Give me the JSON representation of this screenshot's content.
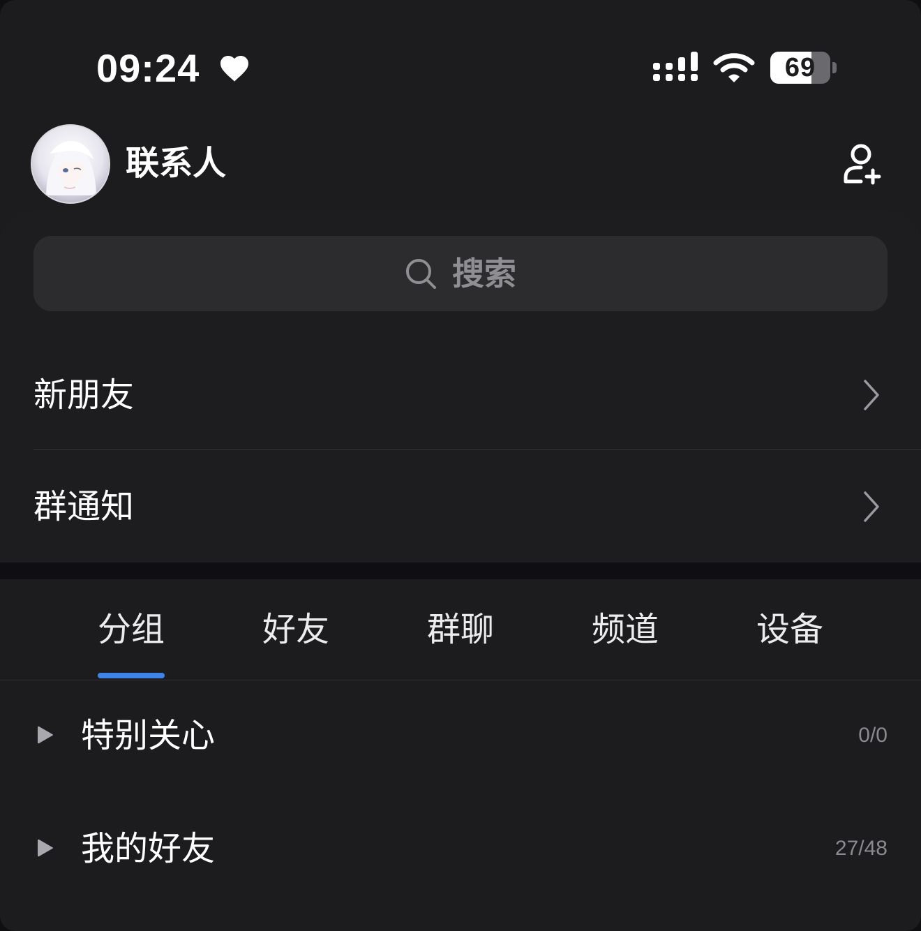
{
  "status_bar": {
    "time": "09:24",
    "battery_level": "69",
    "battery_fraction": 0.69,
    "icons": [
      "heart-icon",
      "signal-icon",
      "wifi-icon",
      "battery-icon"
    ]
  },
  "header": {
    "title": "联系人",
    "avatar_icon": "avatar",
    "add_contact_icon": "add-contact-icon"
  },
  "search": {
    "placeholder": "搜索"
  },
  "menu": {
    "items": [
      {
        "label": "新朋友"
      },
      {
        "label": "群通知"
      }
    ]
  },
  "tabs": {
    "items": [
      {
        "label": "分组"
      },
      {
        "label": "好友"
      },
      {
        "label": "群聊"
      },
      {
        "label": "频道"
      },
      {
        "label": "设备"
      }
    ],
    "active": "分组"
  },
  "groups": {
    "items": [
      {
        "name": "特别关心",
        "count": "0/0"
      },
      {
        "name": "我的好友",
        "count": "27/48"
      }
    ]
  },
  "colors": {
    "background": "#1c1c1e",
    "panel": "#1d1d20",
    "search_bg": "#2c2c2f",
    "accent": "#3f82e8",
    "muted_text": "#8a8a90"
  }
}
